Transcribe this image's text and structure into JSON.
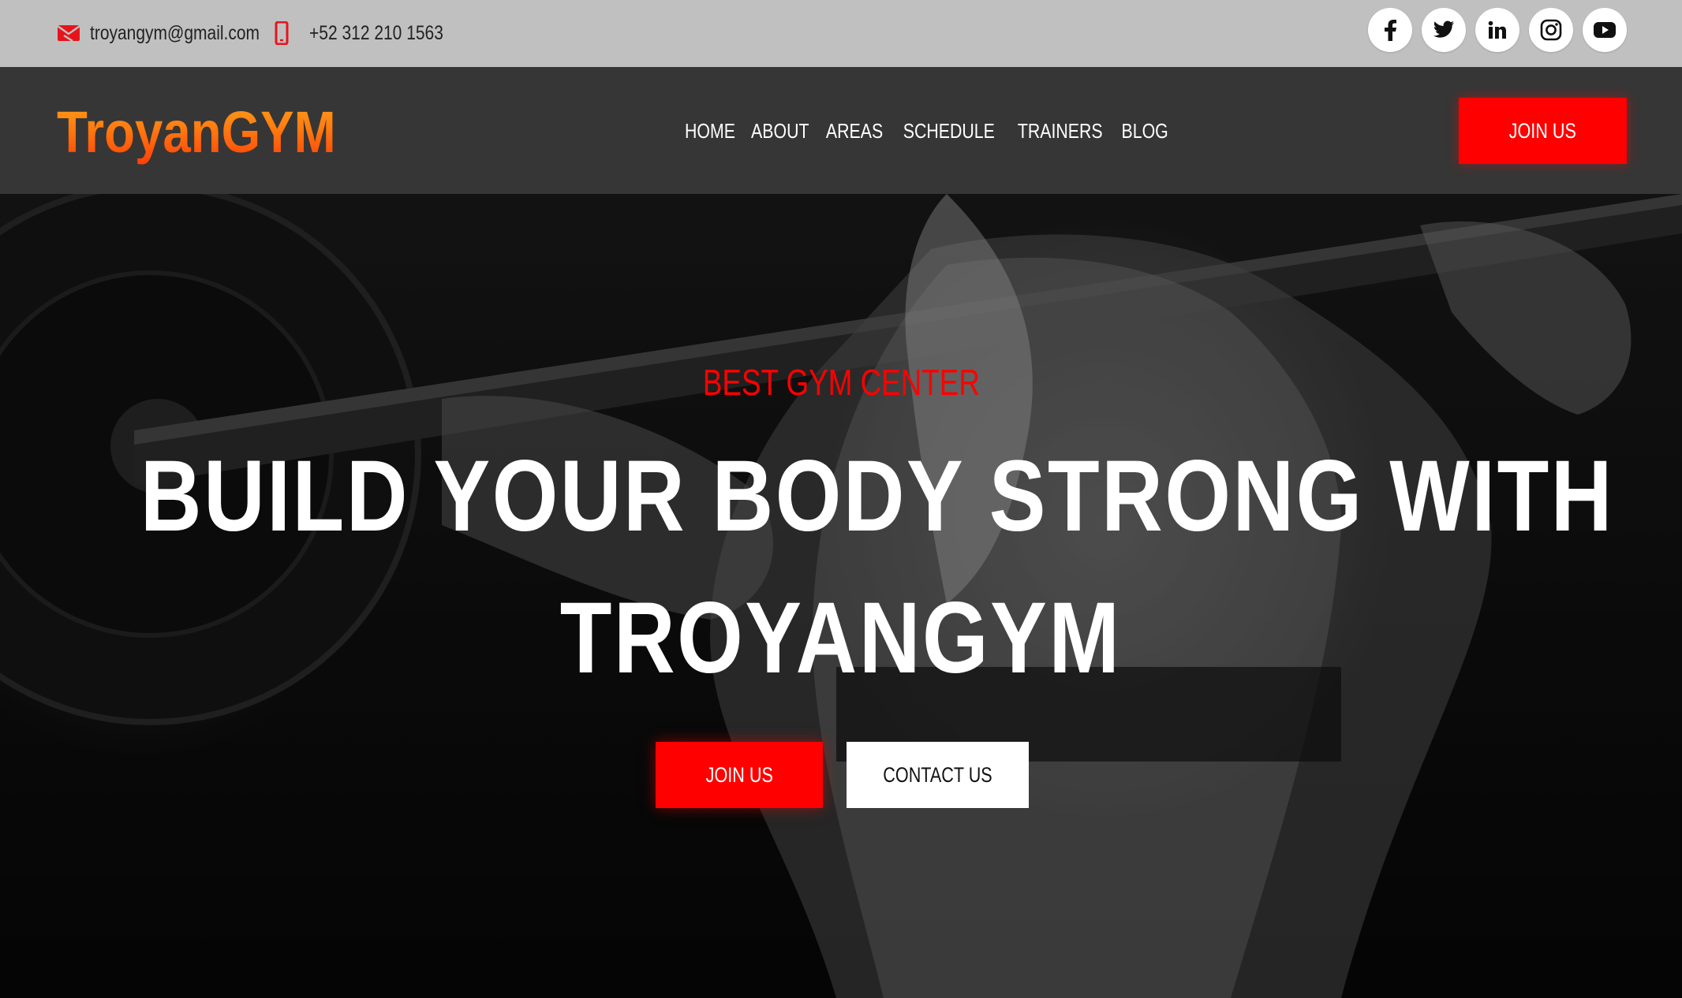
{
  "topbar": {
    "email": "troyangym@gmail.com",
    "phone": "+52 312 210 1563",
    "email_icon": "envelope-icon",
    "phone_icon": "mobile-phone-icon",
    "social": [
      "facebook-icon",
      "twitter-icon",
      "linkedin-icon",
      "instagram-icon",
      "youtube-icon"
    ]
  },
  "navbar": {
    "logo": "TroyanGYM",
    "menu": [
      "HOME",
      "ABOUT",
      "AREAS",
      "SCHEDULE",
      "TRAINERS",
      "BLOG"
    ],
    "join_label": "JOIN US"
  },
  "hero": {
    "kicker": "BEST GYM CENTER",
    "headline_line1": "BUILD YOUR BODY STRONG WITH",
    "headline_line2": "TROYANGYM",
    "join_label": "JOIN US",
    "contact_label": "CONTACT US"
  },
  "colors": {
    "accent": "#fe0000",
    "topbar_bg": "#c0c0c0",
    "navbar_bg": "#363636",
    "logo_gradient_top": "#ffa21a",
    "logo_gradient_bottom": "#ff3d06"
  }
}
